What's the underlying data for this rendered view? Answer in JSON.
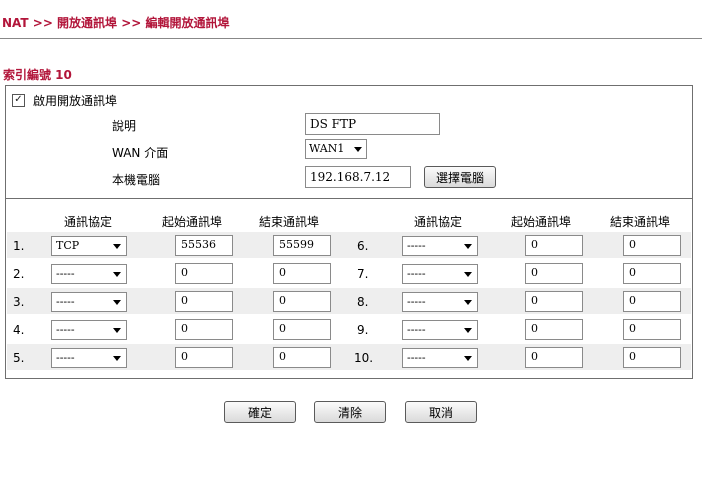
{
  "breadcrumb": "NAT >> 開放通訊埠 >> 編輯開放通訊埠",
  "index_title": "索引編號 10",
  "enable": {
    "label": "啟用開放通訊埠",
    "checked": true,
    "check_glyph": "✓"
  },
  "form": {
    "comment_label": "說明",
    "comment_value": "DS FTP",
    "wan_label": "WAN 介面",
    "wan_value": "WAN1",
    "local_label": "本機電腦",
    "local_value": "192.168.7.12",
    "choose_pc_button": "選擇電腦"
  },
  "table": {
    "headers": {
      "protocol": "通訊協定",
      "start": "起始通訊埠",
      "end": "結束通訊埠"
    },
    "left": [
      {
        "num": "1.",
        "protocol": "TCP",
        "start": "55536",
        "end": "55599"
      },
      {
        "num": "2.",
        "protocol": "-----",
        "start": "0",
        "end": "0"
      },
      {
        "num": "3.",
        "protocol": "-----",
        "start": "0",
        "end": "0"
      },
      {
        "num": "4.",
        "protocol": "-----",
        "start": "0",
        "end": "0"
      },
      {
        "num": "5.",
        "protocol": "-----",
        "start": "0",
        "end": "0"
      }
    ],
    "right": [
      {
        "num": "6.",
        "protocol": "-----",
        "start": "0",
        "end": "0"
      },
      {
        "num": "7.",
        "protocol": "-----",
        "start": "0",
        "end": "0"
      },
      {
        "num": "8.",
        "protocol": "-----",
        "start": "0",
        "end": "0"
      },
      {
        "num": "9.",
        "protocol": "-----",
        "start": "0",
        "end": "0"
      },
      {
        "num": "10.",
        "protocol": "-----",
        "start": "0",
        "end": "0"
      }
    ]
  },
  "buttons": {
    "ok": "確定",
    "clear": "清除",
    "cancel": "取消"
  },
  "colors": {
    "title": "#b2153a",
    "row_shade": "#eeeeee"
  }
}
